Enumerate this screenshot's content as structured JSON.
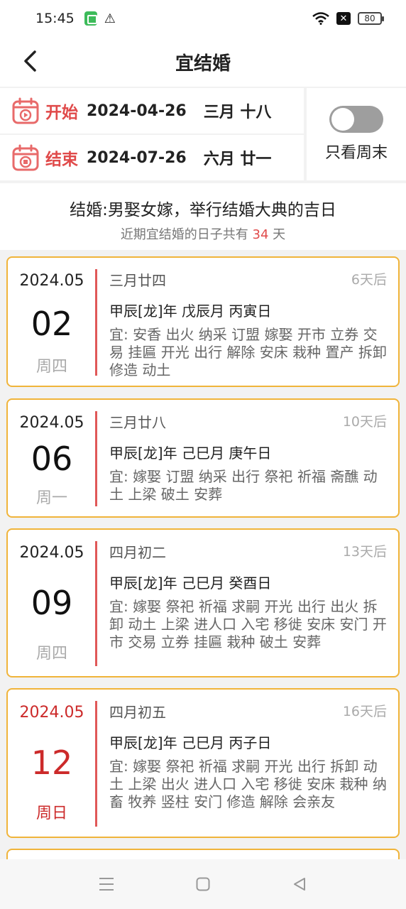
{
  "status": {
    "time": "15:45",
    "battery": "80",
    "x_label": "✕"
  },
  "header": {
    "title": "宜结婚"
  },
  "range": {
    "start_label": "开始",
    "start_date": "2024-04-26",
    "start_lunar": "三月 十八",
    "end_label": "结束",
    "end_date": "2024-07-26",
    "end_lunar": "六月 廿一"
  },
  "weekend_toggle": {
    "label": "只看周末",
    "on": false
  },
  "description": {
    "main": "结婚:男娶女嫁，举行结婚大典的吉日",
    "sub_prefix": "近期宜结婚的日子共有 ",
    "count": "34",
    "sub_suffix": " 天"
  },
  "cards": [
    {
      "year_month": "2024.05",
      "day": "02",
      "weekday": "周四",
      "lunar": "三月廿四",
      "after": "6天后",
      "ganzhi": "甲辰[龙]年 戊辰月 丙寅日",
      "yi": "宜: 安香 出火 纳采 订盟 嫁娶 开市 立券 交易 挂匾 开光 出行 解除 安床 栽种 置产 拆卸 修造 动土",
      "weekend": false
    },
    {
      "year_month": "2024.05",
      "day": "06",
      "weekday": "周一",
      "lunar": "三月廿八",
      "after": "10天后",
      "ganzhi": "甲辰[龙]年 己巳月 庚午日",
      "yi": "宜: 嫁娶 订盟 纳采 出行 祭祀 祈福 斋醮 动土 上梁 破土 安葬",
      "weekend": false
    },
    {
      "year_month": "2024.05",
      "day": "09",
      "weekday": "周四",
      "lunar": "四月初二",
      "after": "13天后",
      "ganzhi": "甲辰[龙]年 己巳月 癸酉日",
      "yi": "宜: 嫁娶 祭祀 祈福 求嗣 开光 出行 出火 拆卸 动土 上梁 进人口 入宅 移徙 安床 安门 开市 交易 立券 挂匾 栽种 破土 安葬",
      "weekend": false
    },
    {
      "year_month": "2024.05",
      "day": "12",
      "weekday": "周日",
      "lunar": "四月初五",
      "after": "16天后",
      "ganzhi": "甲辰[龙]年 己巳月 丙子日",
      "yi": "宜: 嫁娶 祭祀 祈福 求嗣 开光 出行 拆卸 动土 上梁 出火 进人口 入宅 移徙 安床 栽种 纳畜 牧养 竖柱 安门 修造 解除 会亲友",
      "weekend": true
    }
  ],
  "colors": {
    "accent_red": "#e04a4a",
    "card_border": "#f0b43a",
    "weekend_red": "#cc2a2a"
  }
}
